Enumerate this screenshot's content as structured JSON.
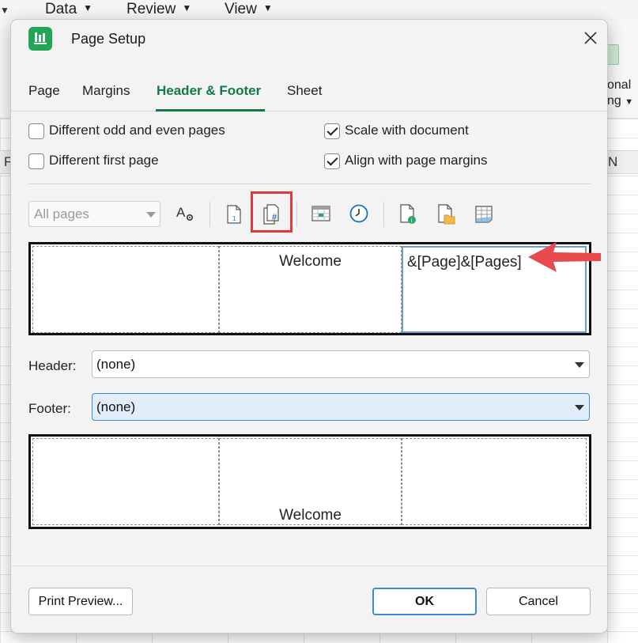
{
  "background": {
    "menus": [
      {
        "label": "Data"
      },
      {
        "label": "Review"
      },
      {
        "label": "View"
      }
    ],
    "ribbon_right_lines": [
      "tional",
      "ting"
    ],
    "column_headers": [
      "F",
      "N"
    ]
  },
  "dialog": {
    "title": "Page Setup",
    "tabs": [
      {
        "label": "Page"
      },
      {
        "label": "Margins"
      },
      {
        "label": "Header & Footer"
      },
      {
        "label": "Sheet"
      }
    ],
    "active_tab": "Header & Footer",
    "options": {
      "different_odd_even": {
        "label": "Different odd and even pages",
        "checked": false
      },
      "different_first": {
        "label": "Different first page",
        "checked": false
      },
      "scale_with_document": {
        "label": "Scale with document",
        "checked": true
      },
      "align_with_margins": {
        "label": "Align with page margins",
        "checked": true
      }
    },
    "toolbar": {
      "pages_select": {
        "value": "All pages",
        "enabled": false
      },
      "tools": [
        {
          "icon": "format-text-icon"
        },
        {
          "icon": "insert-page-number-icon"
        },
        {
          "icon": "insert-page-count-icon",
          "highlighted": true
        },
        {
          "icon": "insert-date-icon"
        },
        {
          "icon": "insert-time-icon"
        },
        {
          "icon": "insert-file-path-icon"
        },
        {
          "icon": "insert-file-name-icon"
        },
        {
          "icon": "insert-sheet-name-icon"
        }
      ]
    },
    "header_preview": {
      "left": "",
      "center": "Welcome",
      "right": "&[Page]&[Pages]"
    },
    "header_field": {
      "label": "Header:",
      "value": "(none)"
    },
    "footer_field": {
      "label": "Footer:",
      "value": "(none)"
    },
    "footer_preview": {
      "left": "",
      "center": "Welcome",
      "right": ""
    },
    "buttons": {
      "print_preview": "Print Preview...",
      "ok": "OK",
      "cancel": "Cancel"
    },
    "colors": {
      "accent_green": "#117a46",
      "highlight_red": "#e0393e",
      "focus_blue": "#3d8ad6"
    }
  }
}
